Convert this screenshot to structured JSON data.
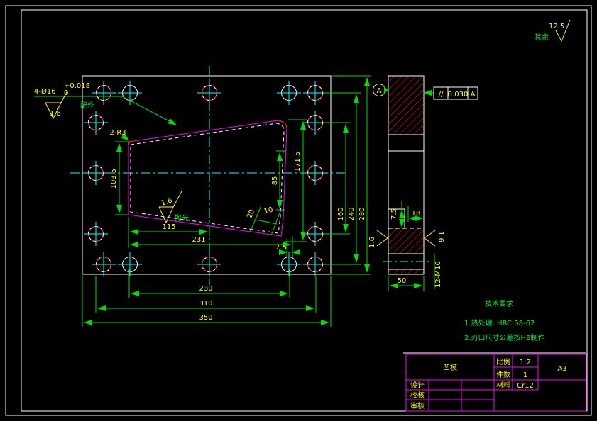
{
  "frame": {
    "surplus_label": "其余",
    "surplus_value": "12.5"
  },
  "main_view": {
    "hole_callout": {
      "text": "4-Ø16",
      "tol_upper": "+0.018",
      "tol_lower": "0",
      "note": "配作",
      "roughness": "1.6"
    },
    "fillet_callout": "2-R3",
    "edge_finish": {
      "roughness": "1.6",
      "note": "抛光"
    },
    "dims": {
      "height_left": "103.5",
      "edge_height": "85",
      "cavity_height": "171.5",
      "hole_span_inner_v": "160",
      "hole_span_outer_v": "240",
      "plate_height": "280",
      "bottom_inner": "115",
      "bottom_mid": "231",
      "step_width": "7.5",
      "slant_a": "20",
      "slant_b": "10",
      "hole_span_inner_h": "230",
      "hole_span_outer_h": "310",
      "plate_width": "350"
    }
  },
  "section_view": {
    "datum_label": "A",
    "fcf": {
      "symbol": "//",
      "tolerance": "0.030",
      "datum": "A"
    },
    "dims": {
      "step_depth": "7.5",
      "ledge": "18",
      "thickness": "50"
    },
    "thread_callout": "12-M16",
    "roughness_left": "1.6",
    "roughness_right": "1.6"
  },
  "tech_requirements": {
    "title": "技术要求",
    "items": [
      "1.热处理: HRC:58-62",
      "2.刃口尺寸公差按H8制作"
    ]
  },
  "title_block": {
    "part_name": "凹模",
    "scale_label": "比例",
    "scale_value": "1:2",
    "qty_label": "件数",
    "qty_value": "1",
    "material_label": "材料",
    "material_value": "Cr12",
    "sheet_size": "A3",
    "sign_rows": [
      {
        "label": "设计"
      },
      {
        "label": "校核"
      },
      {
        "label": "审核"
      }
    ]
  }
}
